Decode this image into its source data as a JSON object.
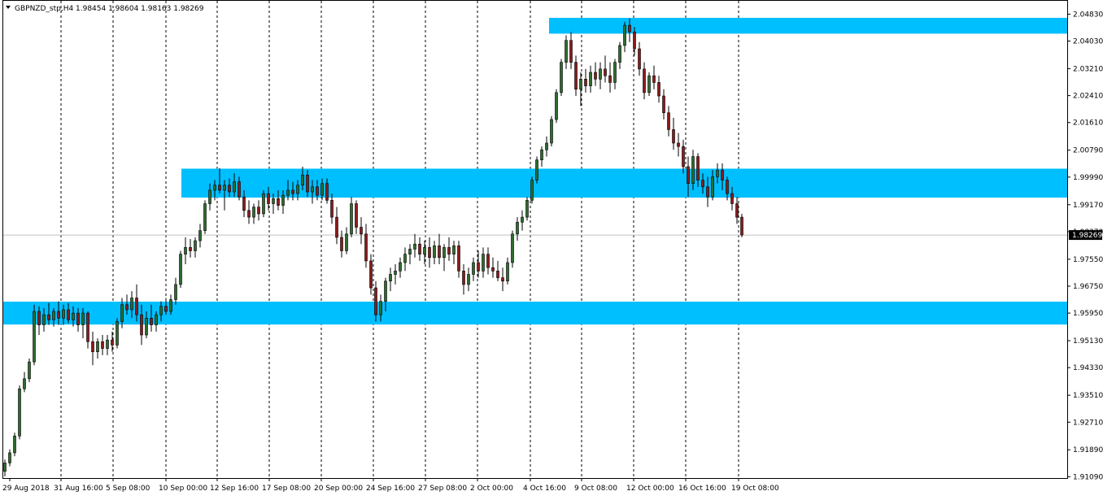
{
  "header": {
    "symbol": "GBPNZD_stp,H4",
    "ohlc": "1.98454 1.98604 1.98163 1.98269"
  },
  "colors": {
    "zone": "#00bfff",
    "bull_body": "#2f6b2f",
    "bear_body": "#8b1a1a",
    "wick": "#000000",
    "grid": "#000000",
    "bid_line": "#c0c0c0",
    "price_tag_bg": "#000000",
    "price_tag_text": "#ffffff"
  },
  "chart_data": {
    "type": "candlestick",
    "title": "",
    "timeframe": "H4",
    "grid": "vertical dotted separators",
    "current_price": 1.98269,
    "ylim": [
      1.9105,
      2.0525
    ],
    "y_ticks": [
      "2.04830",
      "2.04030",
      "2.03210",
      "2.02410",
      "2.01610",
      "2.00790",
      "1.99990",
      "1.99170",
      "1.98370",
      "1.97550",
      "1.96750",
      "1.95950",
      "1.95130",
      "1.94330",
      "1.93510",
      "1.92710",
      "1.91890",
      "1.91090"
    ],
    "x_labels": [
      "29 Aug 2018",
      "31 Aug 16:00",
      "5 Sep 08:00",
      "10 Sep 00:00",
      "12 Sep 16:00",
      "17 Sep 08:00",
      "20 Sep 00:00",
      "24 Sep 16:00",
      "27 Sep 08:00",
      "2 Oct 00:00",
      "4 Oct 16:00",
      "9 Oct 08:00",
      "12 Oct 00:00",
      "16 Oct 16:00",
      "19 Oct 08:00"
    ],
    "zones": [
      {
        "from": 2.0425,
        "to": 2.0472
      },
      {
        "from": 1.9938,
        "to": 2.0024
      },
      {
        "from": 1.9561,
        "to": 1.9629
      }
    ],
    "candles": [
      [
        1.9125,
        1.916,
        1.911,
        1.915
      ],
      [
        1.915,
        1.919,
        1.914,
        1.918
      ],
      [
        1.918,
        1.924,
        1.917,
        1.923
      ],
      [
        1.923,
        1.938,
        1.922,
        1.937
      ],
      [
        1.937,
        1.942,
        1.936,
        1.94
      ],
      [
        1.94,
        1.946,
        1.939,
        1.945
      ],
      [
        1.945,
        1.962,
        1.944,
        1.96
      ],
      [
        1.96,
        1.9615,
        1.953,
        1.956
      ],
      [
        1.956,
        1.961,
        1.954,
        1.959
      ],
      [
        1.959,
        1.9625,
        1.956,
        1.9575
      ],
      [
        1.9575,
        1.961,
        1.9555,
        1.96
      ],
      [
        1.96,
        1.963,
        1.956,
        1.958
      ],
      [
        1.958,
        1.962,
        1.956,
        1.9605
      ],
      [
        1.9605,
        1.9625,
        1.9565,
        1.9575
      ],
      [
        1.9575,
        1.9615,
        1.9555,
        1.9595
      ],
      [
        1.9595,
        1.961,
        1.954,
        1.956
      ],
      [
        1.956,
        1.961,
        1.952,
        1.9595
      ],
      [
        1.9595,
        1.96,
        1.949,
        1.951
      ],
      [
        1.951,
        1.954,
        1.944,
        1.948
      ],
      [
        1.948,
        1.952,
        1.946,
        1.951
      ],
      [
        1.951,
        1.953,
        1.947,
        1.949
      ],
      [
        1.949,
        1.953,
        1.947,
        1.9515
      ],
      [
        1.9515,
        1.954,
        1.948,
        1.95
      ],
      [
        1.95,
        1.958,
        1.949,
        1.957
      ],
      [
        1.957,
        1.964,
        1.955,
        1.962
      ],
      [
        1.962,
        1.965,
        1.959,
        1.9605
      ],
      [
        1.9605,
        1.966,
        1.958,
        1.964
      ],
      [
        1.964,
        1.968,
        1.957,
        1.959
      ],
      [
        1.959,
        1.962,
        1.95,
        1.953
      ],
      [
        1.953,
        1.96,
        1.952,
        1.958
      ],
      [
        1.958,
        1.962,
        1.954,
        1.956
      ],
      [
        1.956,
        1.96,
        1.954,
        1.959
      ],
      [
        1.959,
        1.963,
        1.957,
        1.9615
      ],
      [
        1.9615,
        1.964,
        1.959,
        1.96
      ],
      [
        1.96,
        1.965,
        1.959,
        1.9635
      ],
      [
        1.9635,
        1.97,
        1.962,
        1.968
      ],
      [
        1.968,
        1.978,
        1.967,
        1.977
      ],
      [
        1.977,
        1.982,
        1.974,
        1.979
      ],
      [
        1.979,
        1.9815,
        1.976,
        1.978
      ],
      [
        1.978,
        1.982,
        1.976,
        1.981
      ],
      [
        1.981,
        1.986,
        1.979,
        1.984
      ],
      [
        1.984,
        1.993,
        1.983,
        1.992
      ],
      [
        1.992,
        1.998,
        1.99,
        1.996
      ],
      [
        1.996,
        1.999,
        1.993,
        1.9975
      ],
      [
        1.9975,
        2.0025,
        1.995,
        1.996
      ],
      [
        1.996,
        1.999,
        1.99,
        1.9975
      ],
      [
        1.9975,
        1.9995,
        1.994,
        1.9955
      ],
      [
        1.9955,
        2.001,
        1.994,
        1.9985
      ],
      [
        1.9985,
        2.0,
        1.993,
        1.994
      ],
      [
        1.994,
        1.996,
        1.988,
        1.99
      ],
      [
        1.99,
        1.993,
        1.986,
        1.988
      ],
      [
        1.988,
        1.992,
        1.986,
        1.991
      ],
      [
        1.991,
        1.993,
        1.987,
        1.989
      ],
      [
        1.989,
        1.996,
        1.988,
        1.995
      ],
      [
        1.995,
        1.997,
        1.99,
        1.992
      ],
      [
        1.992,
        1.995,
        1.989,
        1.9935
      ],
      [
        1.9935,
        1.996,
        1.99,
        1.9915
      ],
      [
        1.9915,
        1.996,
        1.989,
        1.9945
      ],
      [
        1.9945,
        1.999,
        1.993,
        1.996
      ],
      [
        1.996,
        1.9985,
        1.993,
        1.995
      ],
      [
        1.995,
        1.999,
        1.993,
        1.9975
      ],
      [
        1.9975,
        2.003,
        1.996,
        2.0005
      ],
      [
        2.0005,
        2.002,
        1.994,
        1.9955
      ],
      [
        1.9955,
        1.999,
        1.992,
        1.997
      ],
      [
        1.997,
        1.999,
        1.993,
        1.9945
      ],
      [
        1.9945,
        1.9995,
        1.993,
        1.998
      ],
      [
        1.998,
        1.9995,
        1.992,
        1.993
      ],
      [
        1.993,
        1.995,
        1.986,
        1.988
      ],
      [
        1.988,
        1.991,
        1.98,
        1.982
      ],
      [
        1.982,
        1.984,
        1.976,
        1.978
      ],
      [
        1.978,
        1.985,
        1.977,
        1.983
      ],
      [
        1.983,
        1.994,
        1.982,
        1.992
      ],
      [
        1.992,
        1.993,
        1.983,
        1.985
      ],
      [
        1.985,
        1.988,
        1.98,
        1.983
      ],
      [
        1.983,
        1.986,
        1.973,
        1.975
      ],
      [
        1.975,
        1.977,
        1.965,
        1.967
      ],
      [
        1.967,
        1.969,
        1.957,
        1.959
      ],
      [
        1.959,
        1.965,
        1.957,
        1.963
      ],
      [
        1.963,
        1.97,
        1.96,
        1.969
      ],
      [
        1.969,
        1.973,
        1.966,
        1.971
      ],
      [
        1.971,
        1.974,
        1.968,
        1.972
      ],
      [
        1.972,
        1.976,
        1.97,
        1.9745
      ],
      [
        1.9745,
        1.979,
        1.972,
        1.977
      ],
      [
        1.977,
        1.98,
        1.974,
        1.9785
      ],
      [
        1.9785,
        1.983,
        1.976,
        1.98
      ],
      [
        1.98,
        1.982,
        1.975,
        1.977
      ],
      [
        1.977,
        1.981,
        1.974,
        1.979
      ],
      [
        1.979,
        1.982,
        1.973,
        1.976
      ],
      [
        1.976,
        1.981,
        1.974,
        1.9795
      ],
      [
        1.9795,
        1.983,
        1.974,
        1.976
      ],
      [
        1.976,
        1.98,
        1.972,
        1.979
      ],
      [
        1.979,
        1.982,
        1.975,
        1.977
      ],
      [
        1.977,
        1.981,
        1.974,
        1.9795
      ],
      [
        1.9795,
        1.981,
        1.97,
        1.972
      ],
      [
        1.972,
        1.974,
        1.965,
        1.968
      ],
      [
        1.968,
        1.973,
        1.966,
        1.971
      ],
      [
        1.971,
        1.976,
        1.969,
        1.9745
      ],
      [
        1.9745,
        1.978,
        1.97,
        1.972
      ],
      [
        1.972,
        1.979,
        1.97,
        1.977
      ],
      [
        1.977,
        1.979,
        1.971,
        1.973
      ],
      [
        1.973,
        1.976,
        1.97,
        1.972
      ],
      [
        1.972,
        1.975,
        1.969,
        1.97
      ],
      [
        1.97,
        1.973,
        1.966,
        1.969
      ],
      [
        1.969,
        1.976,
        1.968,
        1.9745
      ],
      [
        1.9745,
        1.984,
        1.973,
        1.983
      ],
      [
        1.983,
        1.988,
        1.981,
        1.9865
      ],
      [
        1.9865,
        1.99,
        1.984,
        1.988
      ],
      [
        1.988,
        1.994,
        1.987,
        1.993
      ],
      [
        1.993,
        2.0,
        1.992,
        1.999
      ],
      [
        1.999,
        2.006,
        1.998,
        2.005
      ],
      [
        2.005,
        2.009,
        2.003,
        2.008
      ],
      [
        2.008,
        2.012,
        2.006,
        2.01
      ],
      [
        2.01,
        2.018,
        2.009,
        2.017
      ],
      [
        2.017,
        2.026,
        2.016,
        2.025
      ],
      [
        2.025,
        2.035,
        2.024,
        2.034
      ],
      [
        2.034,
        2.042,
        2.032,
        2.0405
      ],
      [
        2.0405,
        2.043,
        2.032,
        2.034
      ],
      [
        2.034,
        2.036,
        2.024,
        2.026
      ],
      [
        2.026,
        2.031,
        2.021,
        2.029
      ],
      [
        2.029,
        2.032,
        2.025,
        2.027
      ],
      [
        2.027,
        2.033,
        2.025,
        2.031
      ],
      [
        2.031,
        2.034,
        2.027,
        2.029
      ],
      [
        2.029,
        2.034,
        2.026,
        2.032
      ],
      [
        2.032,
        2.036,
        2.028,
        2.03
      ],
      [
        2.03,
        2.034,
        2.025,
        2.028
      ],
      [
        2.028,
        2.035,
        2.026,
        2.034
      ],
      [
        2.034,
        2.04,
        2.032,
        2.039
      ],
      [
        2.039,
        2.046,
        2.037,
        2.045
      ],
      [
        2.045,
        2.047,
        2.04,
        2.043
      ],
      [
        2.043,
        2.0445,
        2.036,
        2.038
      ],
      [
        2.038,
        2.04,
        2.03,
        2.032
      ],
      [
        2.032,
        2.034,
        2.023,
        2.025
      ],
      [
        2.025,
        2.031,
        2.024,
        2.03
      ],
      [
        2.03,
        2.033,
        2.026,
        2.028
      ],
      [
        2.028,
        2.03,
        2.022,
        2.024
      ],
      [
        2.024,
        2.026,
        2.017,
        2.019
      ],
      [
        2.019,
        2.021,
        2.012,
        2.014
      ],
      [
        2.014,
        2.0175,
        2.008,
        2.01
      ],
      [
        2.01,
        2.013,
        2.006,
        2.009
      ],
      [
        2.009,
        2.011,
        2.001,
        2.003
      ],
      [
        2.003,
        2.006,
        1.994,
        1.998
      ],
      [
        1.998,
        2.008,
        1.996,
        2.006
      ],
      [
        2.006,
        2.007,
        1.997,
        1.999
      ],
      [
        1.999,
        2.001,
        1.995,
        1.997
      ],
      [
        1.997,
        2.0,
        1.991,
        1.994
      ],
      [
        1.994,
        2.002,
        1.993,
        2.0
      ],
      [
        2.0,
        2.004,
        1.998,
        2.002
      ],
      [
        2.002,
        2.004,
        1.996,
        1.999
      ],
      [
        1.999,
        2.0,
        1.993,
        1.995
      ],
      [
        1.995,
        1.997,
        1.99,
        1.992
      ],
      [
        1.992,
        1.994,
        1.986,
        1.988
      ],
      [
        1.988,
        1.989,
        1.982,
        1.9827
      ]
    ]
  }
}
